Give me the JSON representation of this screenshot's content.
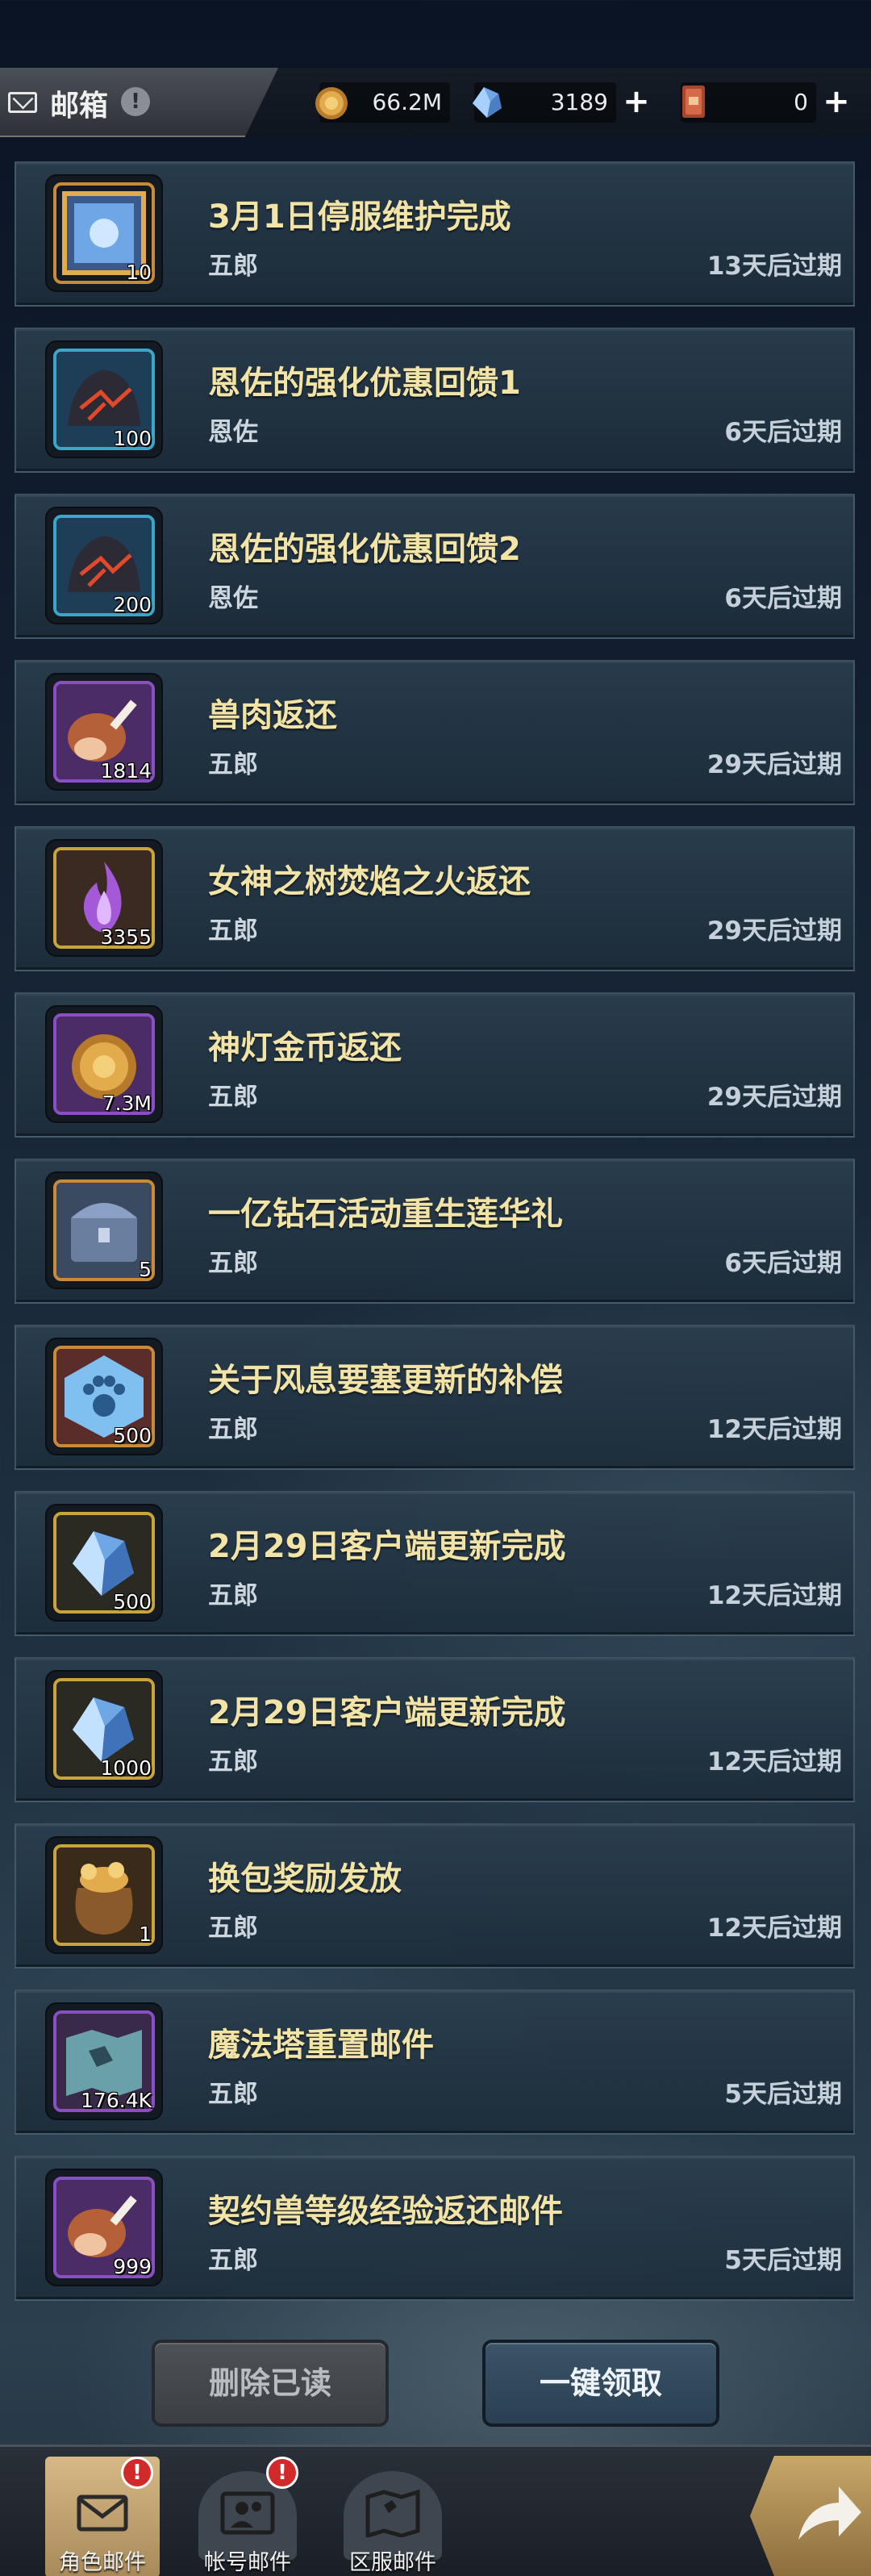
{
  "header": {
    "title": "邮箱",
    "info_icon": "!",
    "currencies": [
      {
        "name": "gold-coin-icon",
        "value": "66.2M",
        "has_plus": false
      },
      {
        "name": "diamond-icon",
        "value": "3189",
        "has_plus": true
      },
      {
        "name": "ticket-icon",
        "value": "0",
        "has_plus": true
      }
    ],
    "plus_label": "+"
  },
  "mails": [
    {
      "title": "3月1日停服维护完成",
      "sender": "五郎",
      "expire": "13天后过期",
      "item_icon": "chest-cube-icon",
      "quantity": "10",
      "frame": "#c98a3a"
    },
    {
      "title": "恩佐的强化优惠回馈1",
      "sender": "恩佐",
      "expire": "6天后过期",
      "item_icon": "enhance-stone-icon",
      "quantity": "100",
      "frame": "#3aa6c9"
    },
    {
      "title": "恩佐的强化优惠回馈2",
      "sender": "恩佐",
      "expire": "6天后过期",
      "item_icon": "enhance-stone-icon",
      "quantity": "200",
      "frame": "#3aa6c9"
    },
    {
      "title": "兽肉返还",
      "sender": "五郎",
      "expire": "29天后过期",
      "item_icon": "meat-icon",
      "quantity": "1814",
      "frame": "#8a4fc4"
    },
    {
      "title": "女神之树焚焰之火返还",
      "sender": "五郎",
      "expire": "29天后过期",
      "item_icon": "purple-flame-icon",
      "quantity": "3355",
      "frame": "#c9a43a"
    },
    {
      "title": "神灯金币返还",
      "sender": "五郎",
      "expire": "29天后过期",
      "item_icon": "gold-coin-icon",
      "quantity": "7.3M",
      "frame": "#8a4fc4"
    },
    {
      "title": "一亿钻石活动重生莲华礼",
      "sender": "五郎",
      "expire": "6天后过期",
      "item_icon": "treasure-chest-icon",
      "quantity": "5",
      "frame": "#c98a3a"
    },
    {
      "title": "关于风息要塞更新的补偿",
      "sender": "五郎",
      "expire": "12天后过期",
      "item_icon": "paw-crystal-icon",
      "quantity": "500",
      "frame": "#c98a3a"
    },
    {
      "title": "2月29日客户端更新完成",
      "sender": "五郎",
      "expire": "12天后过期",
      "item_icon": "diamond-icon",
      "quantity": "500",
      "frame": "#c9a43a"
    },
    {
      "title": "2月29日客户端更新完成",
      "sender": "五郎",
      "expire": "12天后过期",
      "item_icon": "diamond-icon",
      "quantity": "1000",
      "frame": "#c9a43a"
    },
    {
      "title": "换包奖励发放",
      "sender": "五郎",
      "expire": "12天后过期",
      "item_icon": "gold-bag-icon",
      "quantity": "1",
      "frame": "#c9a43a"
    },
    {
      "title": "魔法塔重置邮件",
      "sender": "五郎",
      "expire": "5天后过期",
      "item_icon": "ancient-map-icon",
      "quantity": "176.4K",
      "frame": "#8a4fc4"
    },
    {
      "title": "契约兽等级经验返还邮件",
      "sender": "五郎",
      "expire": "5天后过期",
      "item_icon": "meat-icon",
      "quantity": "999",
      "frame": "#8a4fc4"
    }
  ],
  "actions": {
    "delete_read": "删除已读",
    "claim_all": "一键领取"
  },
  "tabs": [
    {
      "label": "角色邮件",
      "icon": "envelope-icon",
      "badge": "!",
      "active": true
    },
    {
      "label": "帐号邮件",
      "icon": "account-icon",
      "badge": "!",
      "active": false
    },
    {
      "label": "区服邮件",
      "icon": "server-map-icon",
      "badge": "",
      "active": false
    }
  ],
  "back_icon": "return-arrow-icon"
}
